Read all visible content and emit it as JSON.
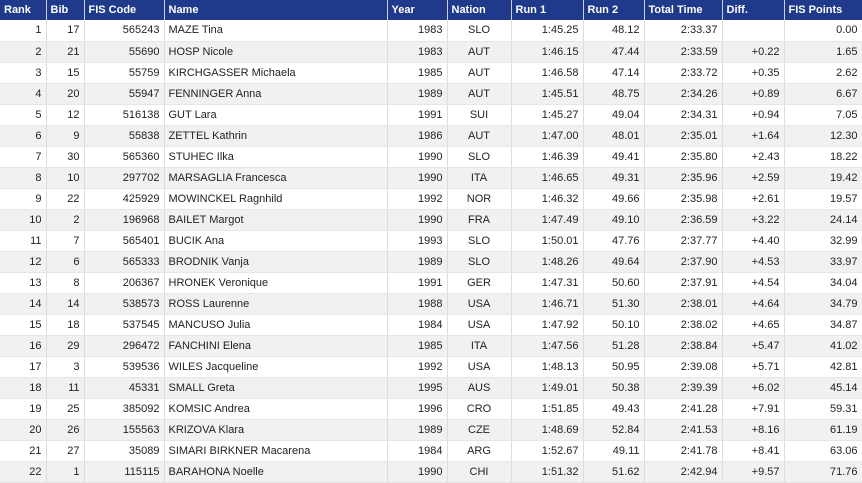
{
  "columns": [
    "Rank",
    "Bib",
    "FIS Code",
    "Name",
    "Year",
    "Nation",
    "Run 1",
    "Run 2",
    "Total Time",
    "Diff.",
    "FIS Points"
  ],
  "rows": [
    {
      "rank": "1",
      "bib": "17",
      "fis_code": "565243",
      "name": "MAZE Tina",
      "year": "1983",
      "nation": "SLO",
      "run1": "1:45.25",
      "run2": "48.12",
      "total": "2:33.37",
      "diff": "",
      "points": "0.00"
    },
    {
      "rank": "2",
      "bib": "21",
      "fis_code": "55690",
      "name": "HOSP Nicole",
      "year": "1983",
      "nation": "AUT",
      "run1": "1:46.15",
      "run2": "47.44",
      "total": "2:33.59",
      "diff": "+0.22",
      "points": "1.65"
    },
    {
      "rank": "3",
      "bib": "15",
      "fis_code": "55759",
      "name": "KIRCHGASSER Michaela",
      "year": "1985",
      "nation": "AUT",
      "run1": "1:46.58",
      "run2": "47.14",
      "total": "2:33.72",
      "diff": "+0.35",
      "points": "2.62"
    },
    {
      "rank": "4",
      "bib": "20",
      "fis_code": "55947",
      "name": "FENNINGER Anna",
      "year": "1989",
      "nation": "AUT",
      "run1": "1:45.51",
      "run2": "48.75",
      "total": "2:34.26",
      "diff": "+0.89",
      "points": "6.67"
    },
    {
      "rank": "5",
      "bib": "12",
      "fis_code": "516138",
      "name": "GUT Lara",
      "year": "1991",
      "nation": "SUI",
      "run1": "1:45.27",
      "run2": "49.04",
      "total": "2:34.31",
      "diff": "+0.94",
      "points": "7.05"
    },
    {
      "rank": "6",
      "bib": "9",
      "fis_code": "55838",
      "name": "ZETTEL Kathrin",
      "year": "1986",
      "nation": "AUT",
      "run1": "1:47.00",
      "run2": "48.01",
      "total": "2:35.01",
      "diff": "+1.64",
      "points": "12.30"
    },
    {
      "rank": "7",
      "bib": "30",
      "fis_code": "565360",
      "name": "STUHEC Ilka",
      "year": "1990",
      "nation": "SLO",
      "run1": "1:46.39",
      "run2": "49.41",
      "total": "2:35.80",
      "diff": "+2.43",
      "points": "18.22"
    },
    {
      "rank": "8",
      "bib": "10",
      "fis_code": "297702",
      "name": "MARSAGLIA Francesca",
      "year": "1990",
      "nation": "ITA",
      "run1": "1:46.65",
      "run2": "49.31",
      "total": "2:35.96",
      "diff": "+2.59",
      "points": "19.42"
    },
    {
      "rank": "9",
      "bib": "22",
      "fis_code": "425929",
      "name": "MOWINCKEL Ragnhild",
      "year": "1992",
      "nation": "NOR",
      "run1": "1:46.32",
      "run2": "49.66",
      "total": "2:35.98",
      "diff": "+2.61",
      "points": "19.57"
    },
    {
      "rank": "10",
      "bib": "2",
      "fis_code": "196968",
      "name": "BAILET Margot",
      "year": "1990",
      "nation": "FRA",
      "run1": "1:47.49",
      "run2": "49.10",
      "total": "2:36.59",
      "diff": "+3.22",
      "points": "24.14"
    },
    {
      "rank": "11",
      "bib": "7",
      "fis_code": "565401",
      "name": "BUCIK Ana",
      "year": "1993",
      "nation": "SLO",
      "run1": "1:50.01",
      "run2": "47.76",
      "total": "2:37.77",
      "diff": "+4.40",
      "points": "32.99"
    },
    {
      "rank": "12",
      "bib": "6",
      "fis_code": "565333",
      "name": "BRODNIK Vanja",
      "year": "1989",
      "nation": "SLO",
      "run1": "1:48.26",
      "run2": "49.64",
      "total": "2:37.90",
      "diff": "+4.53",
      "points": "33.97"
    },
    {
      "rank": "13",
      "bib": "8",
      "fis_code": "206367",
      "name": "HRONEK Veronique",
      "year": "1991",
      "nation": "GER",
      "run1": "1:47.31",
      "run2": "50.60",
      "total": "2:37.91",
      "diff": "+4.54",
      "points": "34.04"
    },
    {
      "rank": "14",
      "bib": "14",
      "fis_code": "538573",
      "name": "ROSS Laurenne",
      "year": "1988",
      "nation": "USA",
      "run1": "1:46.71",
      "run2": "51.30",
      "total": "2:38.01",
      "diff": "+4.64",
      "points": "34.79"
    },
    {
      "rank": "15",
      "bib": "18",
      "fis_code": "537545",
      "name": "MANCUSO Julia",
      "year": "1984",
      "nation": "USA",
      "run1": "1:47.92",
      "run2": "50.10",
      "total": "2:38.02",
      "diff": "+4.65",
      "points": "34.87"
    },
    {
      "rank": "16",
      "bib": "29",
      "fis_code": "296472",
      "name": "FANCHINI Elena",
      "year": "1985",
      "nation": "ITA",
      "run1": "1:47.56",
      "run2": "51.28",
      "total": "2:38.84",
      "diff": "+5.47",
      "points": "41.02"
    },
    {
      "rank": "17",
      "bib": "3",
      "fis_code": "539536",
      "name": "WILES Jacqueline",
      "year": "1992",
      "nation": "USA",
      "run1": "1:48.13",
      "run2": "50.95",
      "total": "2:39.08",
      "diff": "+5.71",
      "points": "42.81"
    },
    {
      "rank": "18",
      "bib": "11",
      "fis_code": "45331",
      "name": "SMALL Greta",
      "year": "1995",
      "nation": "AUS",
      "run1": "1:49.01",
      "run2": "50.38",
      "total": "2:39.39",
      "diff": "+6.02",
      "points": "45.14"
    },
    {
      "rank": "19",
      "bib": "25",
      "fis_code": "385092",
      "name": "KOMSIC Andrea",
      "year": "1996",
      "nation": "CRO",
      "run1": "1:51.85",
      "run2": "49.43",
      "total": "2:41.28",
      "diff": "+7.91",
      "points": "59.31"
    },
    {
      "rank": "20",
      "bib": "26",
      "fis_code": "155563",
      "name": "KRIZOVA Klara",
      "year": "1989",
      "nation": "CZE",
      "run1": "1:48.69",
      "run2": "52.84",
      "total": "2:41.53",
      "diff": "+8.16",
      "points": "61.19"
    },
    {
      "rank": "21",
      "bib": "27",
      "fis_code": "35089",
      "name": "SIMARI BIRKNER Macarena",
      "year": "1984",
      "nation": "ARG",
      "run1": "1:52.67",
      "run2": "49.11",
      "total": "2:41.78",
      "diff": "+8.41",
      "points": "63.06"
    },
    {
      "rank": "22",
      "bib": "1",
      "fis_code": "115115",
      "name": "BARAHONA Noelle",
      "year": "1990",
      "nation": "CHI",
      "run1": "1:51.32",
      "run2": "51.62",
      "total": "2:42.94",
      "diff": "+9.57",
      "points": "71.76"
    }
  ],
  "colors": {
    "header_bg": "#1f3a8a",
    "header_text": "#ffffff",
    "row_alt": "#f1f1f1"
  }
}
